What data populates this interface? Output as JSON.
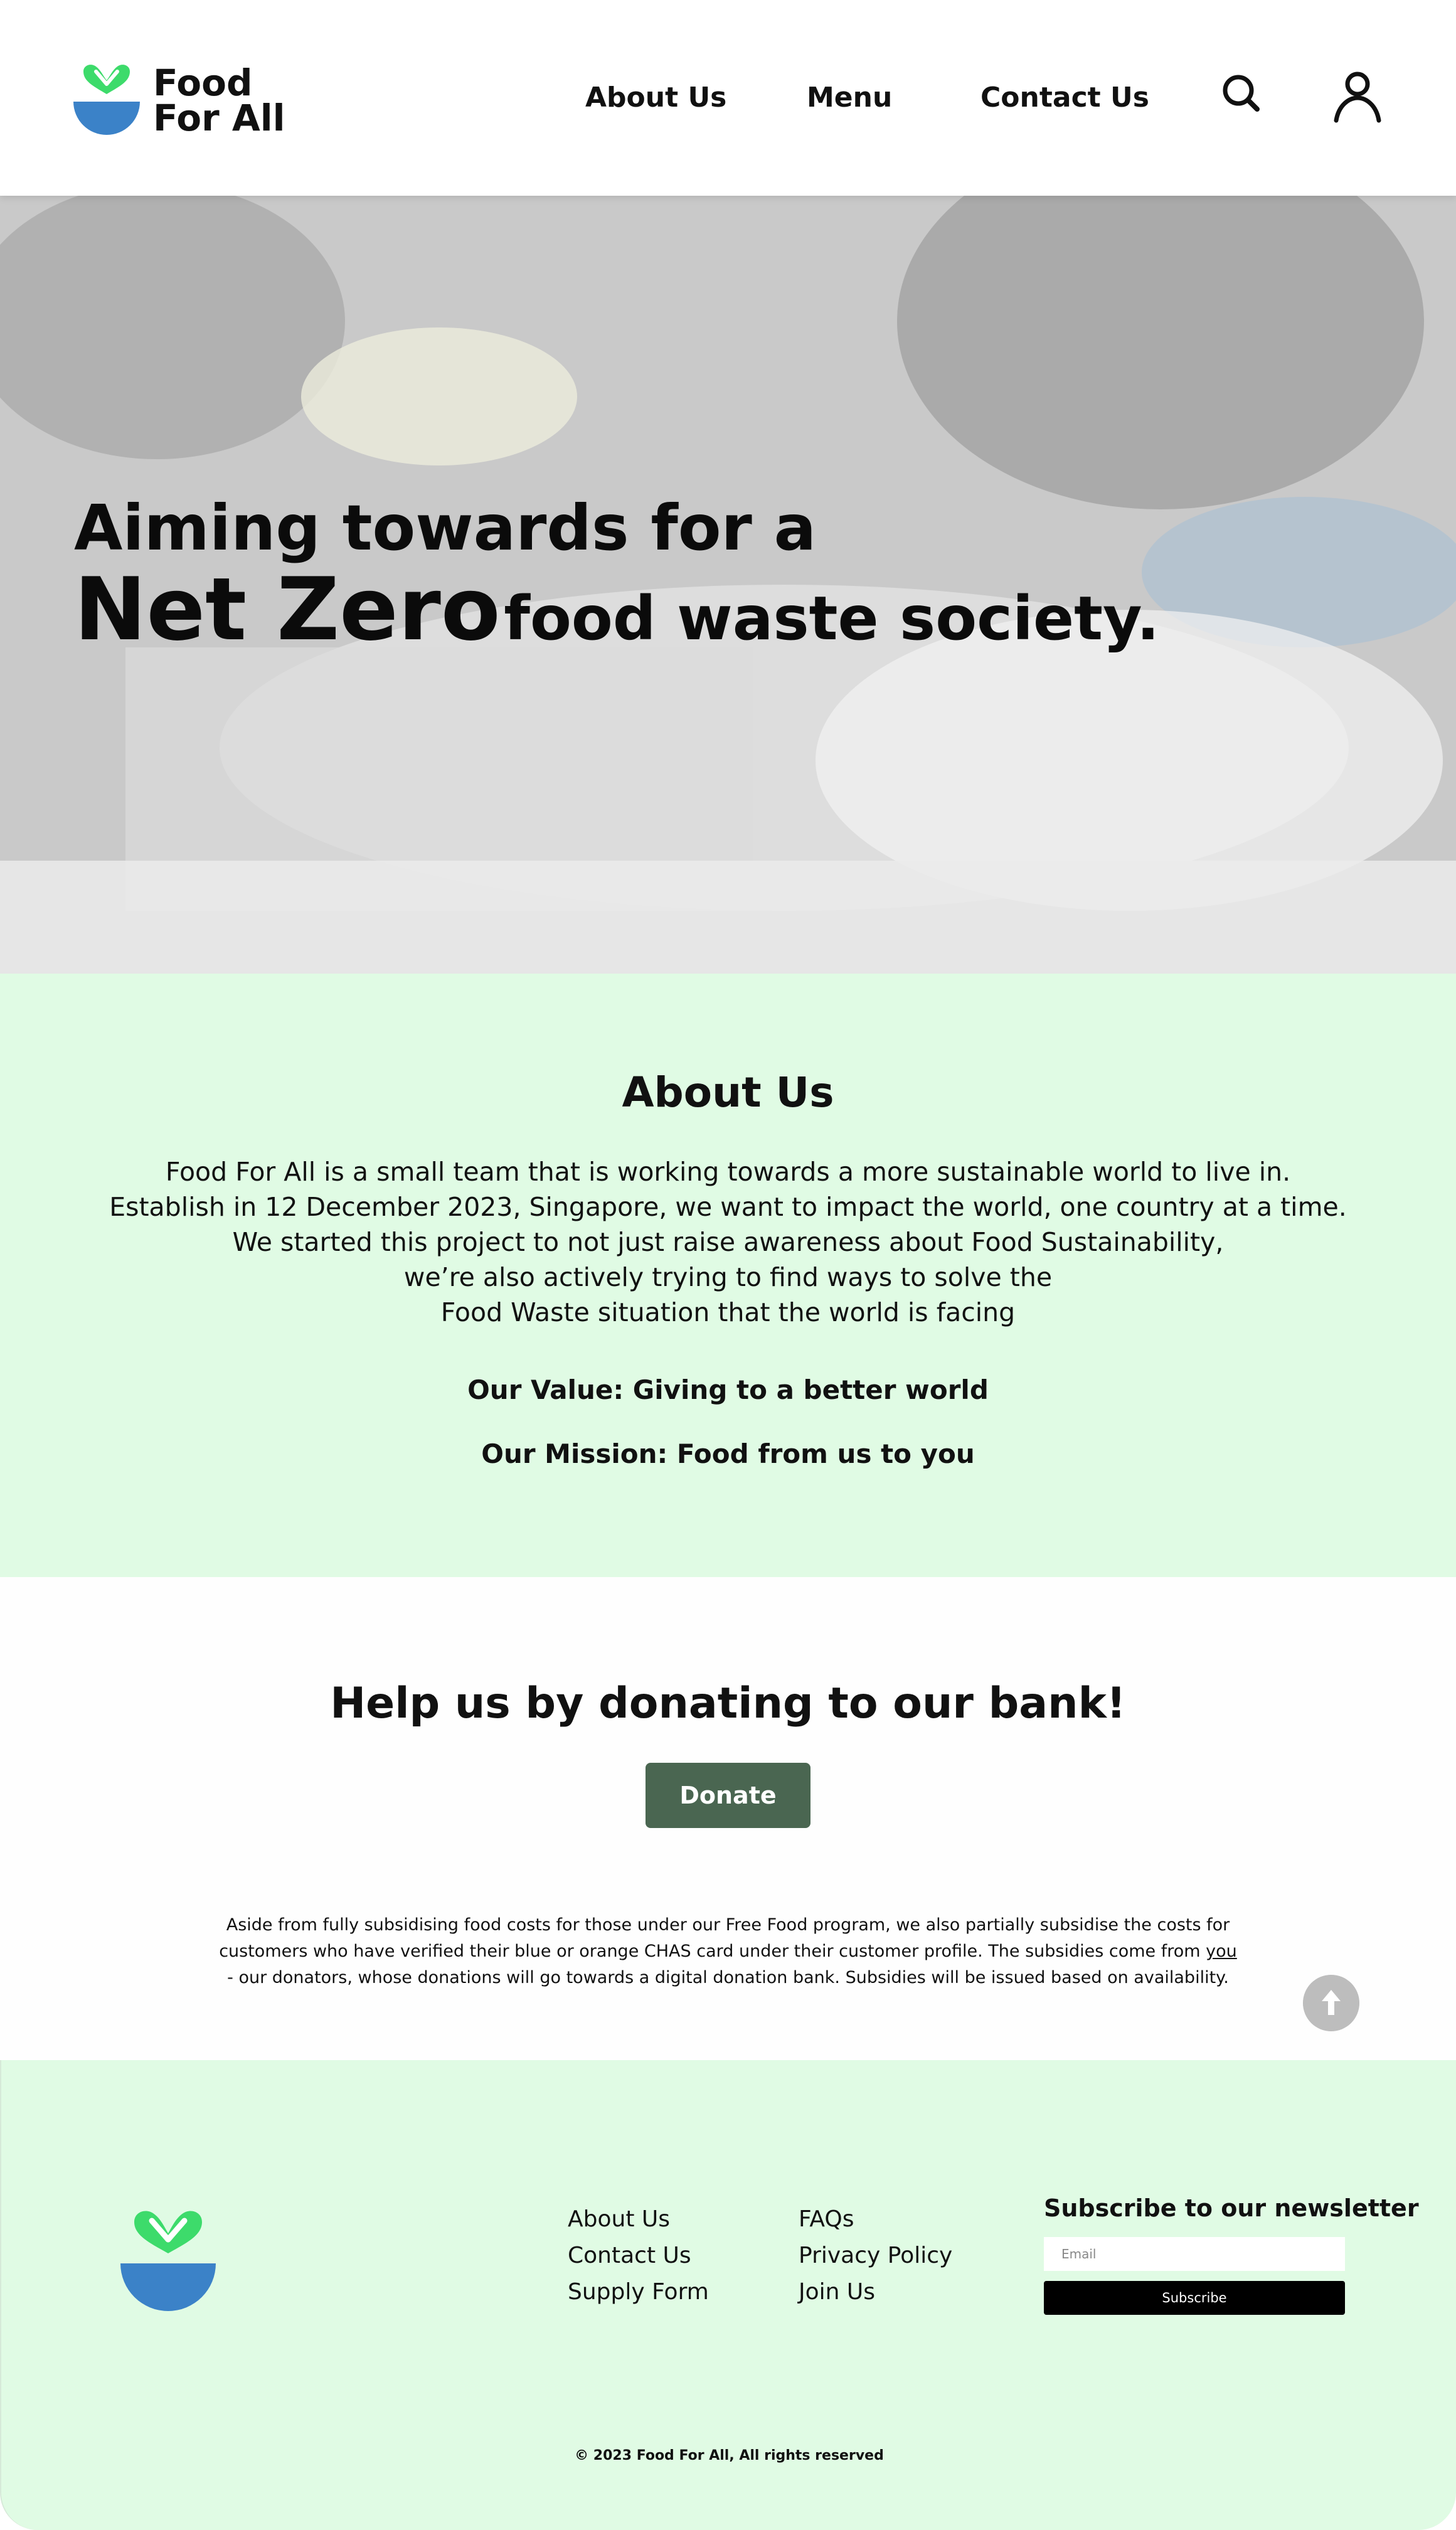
{
  "header": {
    "brand_line1": "Food",
    "brand_line2": "For All",
    "nav": [
      "About Us",
      "Menu",
      "Contact Us"
    ],
    "icons": [
      "search-icon",
      "user-icon"
    ]
  },
  "hero": {
    "line1": "Aiming towards for a",
    "emphasis": "Net Zero",
    "line2_rest": "food waste society."
  },
  "about": {
    "title": "About Us",
    "paragraph": [
      "Food For All is a small team that is working towards a more sustainable world to live in.",
      "Establish in 12 December 2023, Singapore, we want to impact the world, one country at a time.",
      "We started this project to not just raise awareness about Food Sustainability,",
      "we’re also actively trying to find ways to solve the",
      "Food Waste situation that the world is facing"
    ],
    "value": "Our Value: Giving to a better world",
    "mission": "Our Mission: Food from us to you"
  },
  "donate": {
    "title": "Help us by donating to our bank!",
    "button_label": "Donate",
    "fineprint_line1": "Aside from fully subsidising food costs for those under our Free Food program, we also partially subsidise the costs for",
    "fineprint_line2_pre": "customers who have verified their blue or orange CHAS card under their customer profile. The subsidies come from ",
    "fineprint_link": "you",
    "fineprint_line3": "- our donators, whose donations will go towards a digital donation bank. Subsidies will be issued based on availability."
  },
  "footer": {
    "col1": [
      "About Us",
      "Contact Us",
      "Supply Form"
    ],
    "col2": [
      "FAQs",
      "Privacy Policy",
      "Join Us"
    ],
    "newsletter_title": "Subscribe to our newsletter",
    "email_placeholder": "Email",
    "subscribe_label": "Subscribe",
    "copyright": "© 2023 Food For All, All rights reserved"
  },
  "colors": {
    "logo_green": "#3ddb6b",
    "logo_blue": "#3b82c8",
    "mint_bg": "#e0fbe4",
    "donate_button": "#4a6651",
    "scroll_top_button": "#bdbdbd"
  }
}
